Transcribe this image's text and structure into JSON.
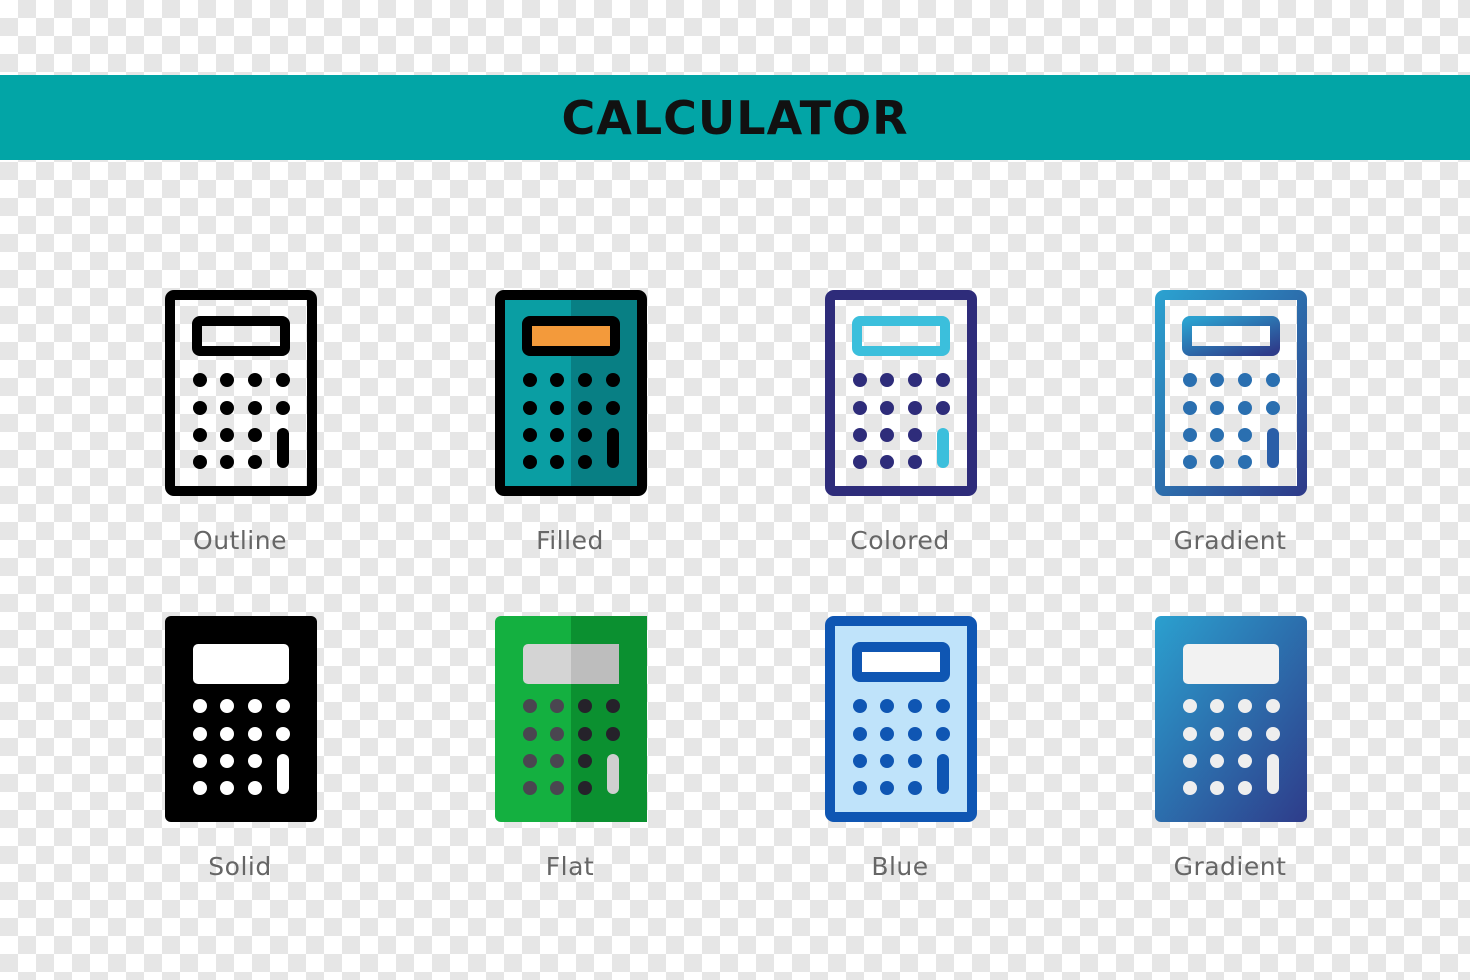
{
  "banner": {
    "title": "CALCULATOR",
    "background": "#02a5a6"
  },
  "icons": [
    {
      "label": "Outline",
      "style": "outline"
    },
    {
      "label": "Filled",
      "style": "filled"
    },
    {
      "label": "Colored",
      "style": "colored"
    },
    {
      "label": "Gradient",
      "style": "gradient-outline"
    },
    {
      "label": "Solid",
      "style": "solid"
    },
    {
      "label": "Flat",
      "style": "flat"
    },
    {
      "label": "Blue",
      "style": "blue"
    },
    {
      "label": "Gradient",
      "style": "gradient-solid"
    }
  ],
  "colors": {
    "filled_body": "#0a9ea3",
    "filled_shade": "#087f84",
    "filled_screen": "#f39a3b",
    "colored_frame": "#2e2c7a",
    "colored_accent": "#3bbfdc",
    "flat_body": "#14b040",
    "flat_shade": "#0b9030",
    "flat_screen": "#d4d4d4",
    "blue_frame": "#0f56b3",
    "blue_fill": "#bfe3fa",
    "gradient_start": "#2ba0cf",
    "gradient_end": "#2e3c8a"
  }
}
